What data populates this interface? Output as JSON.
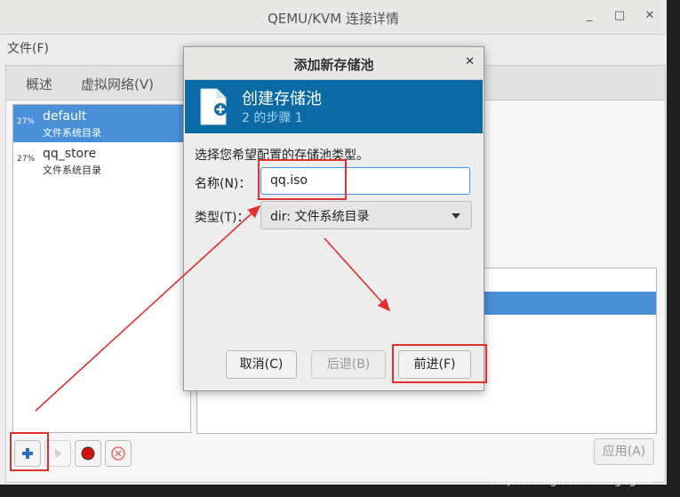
{
  "window": {
    "title": "QEMU/KVM 连接详情",
    "minimize_label": "_",
    "maximize_label": "□",
    "close_label": "✕"
  },
  "menu": {
    "file": "文件(F)"
  },
  "tabs": [
    {
      "label": "概述"
    },
    {
      "label": "虚拟网络(V)"
    }
  ],
  "pools": [
    {
      "usage": "27%",
      "name": "default",
      "type": "文件系统目录",
      "selected": true
    },
    {
      "usage": "27%",
      "name": "qq_store",
      "type": "文件系统目录",
      "selected": false
    }
  ],
  "toolbar": {
    "apply_label": "应用(A)"
  },
  "dialog": {
    "title": "添加新存储池",
    "close_label": "✕",
    "header_title": "创建存储池",
    "header_step": "2 的步骤 1",
    "prompt": "选择您希望配置的存储池类型。",
    "name_label": "名称(N)：",
    "name_value": "qq.iso",
    "type_label": "类型(T)：",
    "type_value": "dir: 文件系统目录",
    "cancel_label": "取消(C)",
    "back_label": "后退(B)",
    "forward_label": "前进(F)"
  },
  "watermark": "https://blog.csdn.net/guguai",
  "colors": {
    "accent": "#4a90d9",
    "header_blue": "#0b6aa3",
    "annotation_red": "#e03030"
  }
}
